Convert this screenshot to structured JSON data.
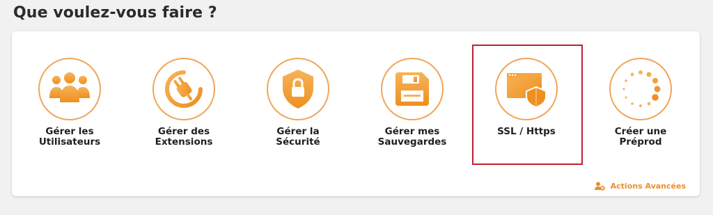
{
  "page": {
    "title": "Que voulez-vous faire ?"
  },
  "colors": {
    "accent": "#f39c2b",
    "accent_light": "#f6b35a",
    "circle_border": "#f0a55a",
    "selected_outline": "#c01f2e"
  },
  "actions": [
    {
      "label": "Gérer les\nUtilisateurs",
      "icon": "users-icon"
    },
    {
      "label": "Gérer des\nExtensions",
      "icon": "plug-icon"
    },
    {
      "label": "Gérer la\nSécurité",
      "icon": "shield-lock-icon"
    },
    {
      "label": "Gérer mes\nSauvegardes",
      "icon": "floppy-disk-icon"
    },
    {
      "label": "SSL / Https",
      "icon": "browser-shield-icon",
      "selected": true
    },
    {
      "label": "Créer une\nPréprod",
      "icon": "loading-dots-icon"
    }
  ],
  "advanced": {
    "label": "Actions Avancées",
    "icon": "user-gear-icon"
  }
}
